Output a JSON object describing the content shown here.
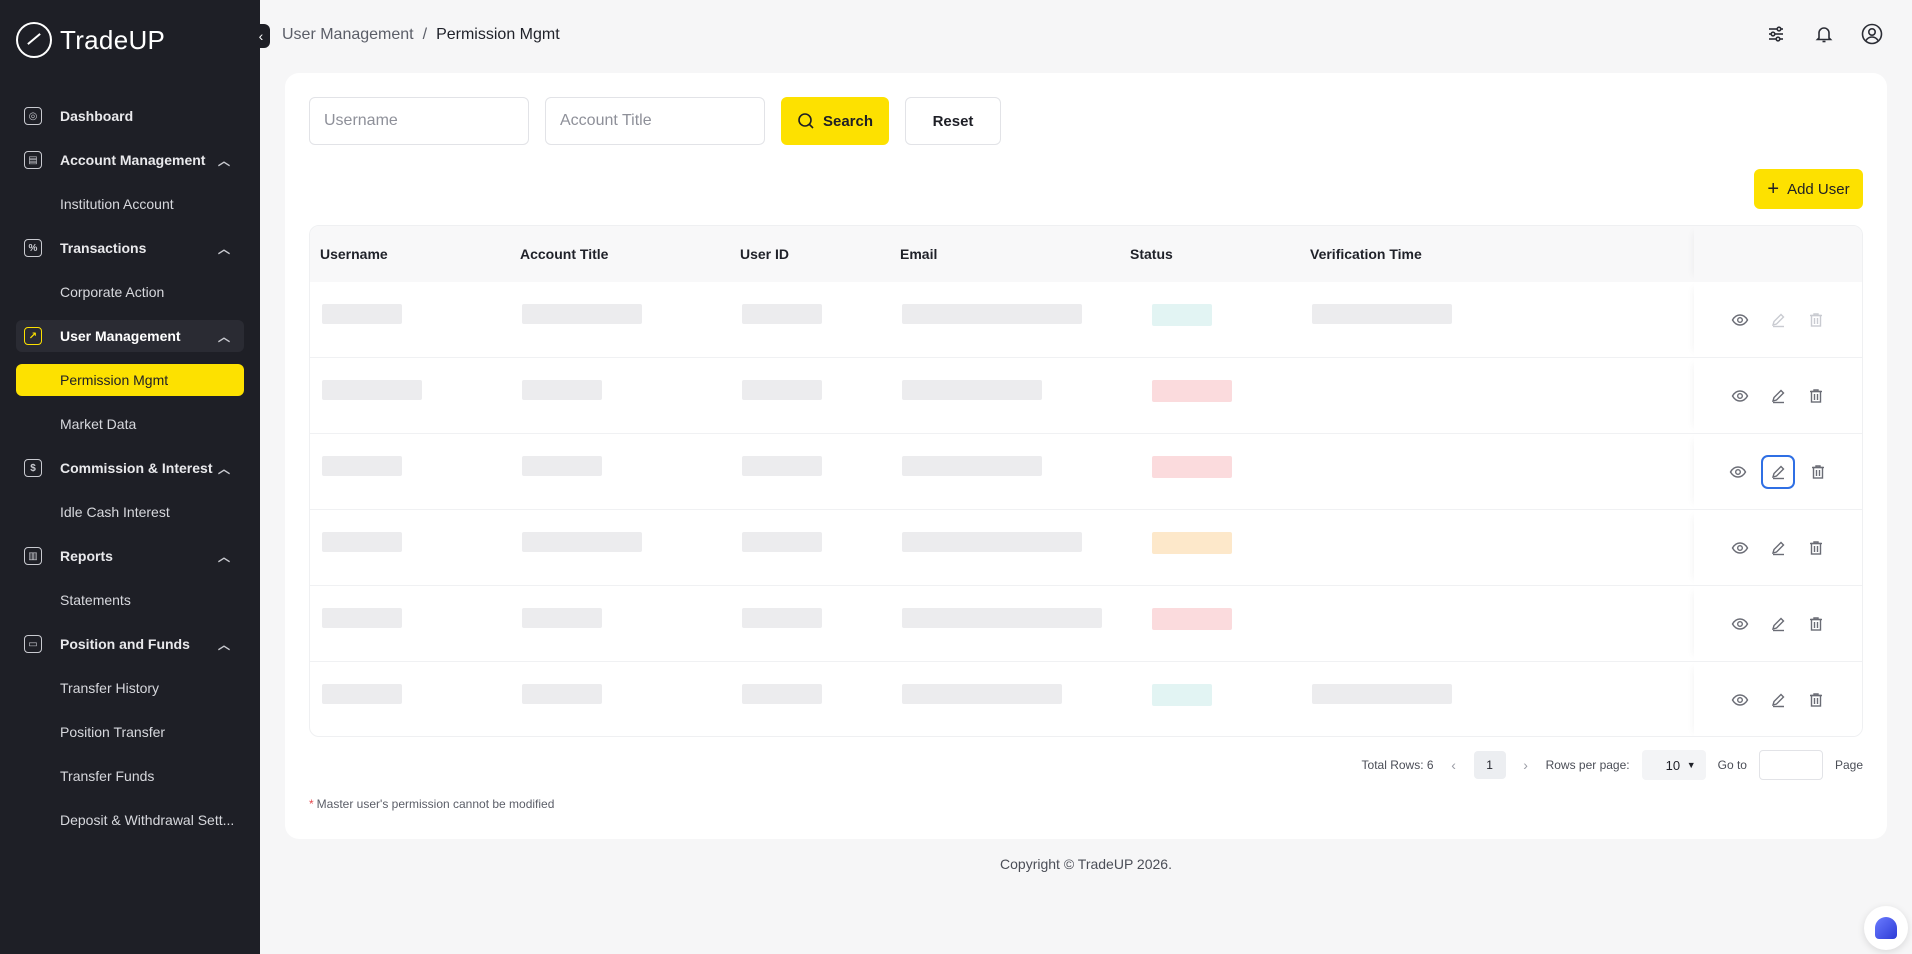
{
  "app": {
    "brand": "TradeUP"
  },
  "sidebar": {
    "menu": [
      {
        "label": "Dashboard",
        "icon": "dashboard-icon",
        "expandable": false
      },
      {
        "label": "Account Management",
        "icon": "account-icon",
        "expandable": true,
        "children": [
          "Institution Account"
        ]
      },
      {
        "label": "Transactions",
        "icon": "transactions-icon",
        "expandable": true,
        "children": [
          "Corporate Action"
        ]
      },
      {
        "label": "User Management",
        "icon": "user-management-icon",
        "expandable": true,
        "active": true,
        "children": [
          "Permission Mgmt",
          "Market Data"
        ]
      },
      {
        "label": "Commission & Interest",
        "icon": "commission-icon",
        "expandable": true,
        "children": [
          "Idle Cash Interest"
        ]
      },
      {
        "label": "Reports",
        "icon": "reports-icon",
        "expandable": true,
        "children": [
          "Statements"
        ]
      },
      {
        "label": "Position and Funds",
        "icon": "wallet-icon",
        "expandable": true,
        "children": [
          "Transfer History",
          "Position Transfer",
          "Transfer Funds",
          "Deposit & Withdrawal Sett..."
        ]
      }
    ],
    "active_item": "Permission Mgmt"
  },
  "header": {
    "breadcrumb": [
      "User Management",
      "Permission Mgmt"
    ],
    "separator": "/",
    "icons": [
      "filter-settings-icon",
      "notification-bell-icon",
      "user-profile-icon"
    ]
  },
  "filters": {
    "username_placeholder": "Username",
    "account_title_placeholder": "Account Title",
    "search_label": "Search",
    "reset_label": "Reset"
  },
  "toolbar": {
    "add_user_label": "Add User"
  },
  "table": {
    "columns": [
      "Username",
      "Account Title",
      "User ID",
      "Email",
      "Status",
      "Verification Time"
    ],
    "row_count": 6,
    "row_status_colors": [
      "#dff3f2",
      "#fbd7d9",
      "#fbd7d9",
      "#fde6c4",
      "#fbd7d9",
      "#dff3f2"
    ],
    "actions": [
      "view-icon",
      "edit-icon",
      "delete-icon"
    ]
  },
  "pagination": {
    "total_rows_label": "Total Rows: 6",
    "current_page": "1",
    "rows_per_page_label": "Rows per page:",
    "rows_per_page": "10",
    "goto_label": "Go to",
    "page_label": "Page"
  },
  "note": {
    "asterisk": "*",
    "text": "Master user's permission cannot be modified"
  },
  "footer": {
    "copyright": "Copyright © TradeUP 2026."
  },
  "colors": {
    "accent": "#fde100",
    "sidebar_bg": "#1e1f26",
    "focus_outline": "#2f6fe4"
  }
}
